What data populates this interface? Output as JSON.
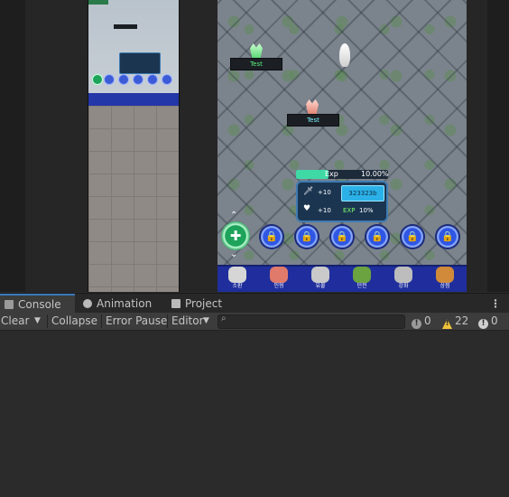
{
  "game": {
    "name_tags": [
      "Test",
      "Test"
    ],
    "exp_label": "Exp",
    "exp_percent_label": "10.00%",
    "exp_fraction": 0.35,
    "attack_bonus": "+10",
    "health_bonus": "+10",
    "gold_value": "323323b",
    "exp_bonus_label": "EXP",
    "exp_bonus_value": "10%",
    "lock_icon": "🔒",
    "shield_icon": "✚",
    "arrow_up": "⌃",
    "arrow_down": "⌄",
    "nav": [
      {
        "label": "소환",
        "icon": "hero-icon",
        "color": "#d6d6d6"
      },
      {
        "label": "인형",
        "icon": "doll-icon",
        "color": "#e07a6a"
      },
      {
        "label": "유물",
        "icon": "relic-icon",
        "color": "#c9c9c9"
      },
      {
        "label": "던전",
        "icon": "dungeon-icon",
        "color": "#6aa33f"
      },
      {
        "label": "강화",
        "icon": "hammer-icon",
        "color": "#bdbdbd"
      },
      {
        "label": "상점",
        "icon": "shop-icon",
        "color": "#d08a3a"
      }
    ]
  },
  "tabs": [
    {
      "label": "Console",
      "icon": "console-icon"
    },
    {
      "label": "Animation",
      "icon": "animation-icon"
    },
    {
      "label": "Project",
      "icon": "folder-icon"
    }
  ],
  "toolbar": {
    "clear": "Clear",
    "collapse": "Collapse",
    "error_pause": "Error Pause",
    "editor": "Editor",
    "search_placeholder": ""
  },
  "counts": {
    "info": "0",
    "warning": "22",
    "error": "0"
  },
  "colors": {
    "accent": "#3a79bb",
    "warning": "#f0c23a",
    "info": "#9a9a9a",
    "error": "#cfcfcf"
  }
}
